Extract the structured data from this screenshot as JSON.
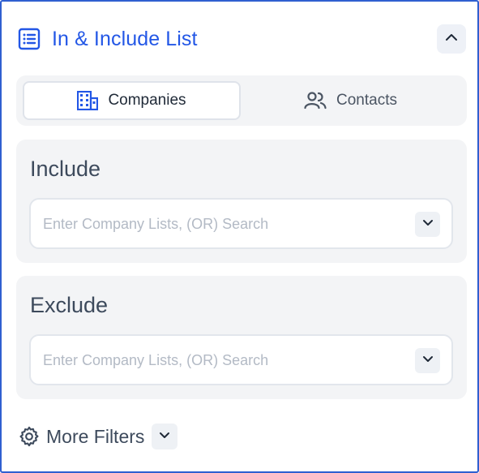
{
  "header": {
    "title": "In & Include List",
    "icon": "list-icon",
    "collapse_icon": "chevron-up-icon"
  },
  "toggle": {
    "options": [
      {
        "label": "Companies",
        "icon": "building-icon",
        "selected": true
      },
      {
        "label": "Contacts",
        "icon": "users-icon",
        "selected": false
      }
    ]
  },
  "include": {
    "title": "Include",
    "placeholder": "Enter Company Lists, (OR) Search"
  },
  "exclude": {
    "title": "Exclude",
    "placeholder": "Enter Company Lists, (OR) Search"
  },
  "more_filters": {
    "label": "More Filters",
    "icon": "gear-icon"
  },
  "colors": {
    "accent": "#2357e6",
    "border": "#2f5fd0",
    "section_bg": "#f3f4f6",
    "text": "#3d4a5c",
    "placeholder": "#b3bac5"
  }
}
